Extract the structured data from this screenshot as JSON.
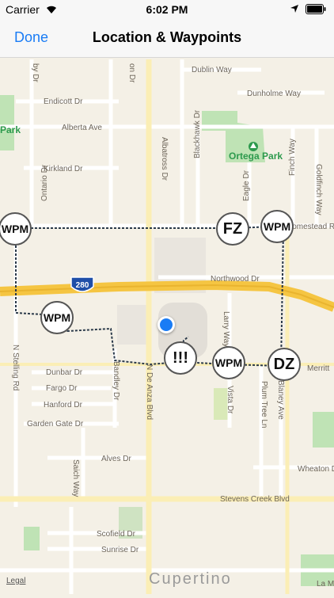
{
  "status": {
    "carrier": "Carrier",
    "time": "6:02 PM"
  },
  "nav": {
    "done": "Done",
    "title": "Location & Waypoints"
  },
  "map": {
    "streets": {
      "dublin": "Dublin Way",
      "dunholme": "Dunholme Way",
      "endicott": "Endicott Dr",
      "alberta": "Alberta Ave",
      "kirkland": "Kirkland Dr",
      "ontario": "Ontario Dr",
      "albatross": "Albatross Dr",
      "blackhawk": "Blackhawk Dr",
      "eagle": "Eagle Dr",
      "finch": "Finch Way",
      "goldfinch": "Goldfinch Way",
      "homestead": "Homestead Rd",
      "northwood": "Northwood Dr",
      "larry": "Larry Way",
      "dunbar": "Dunbar Dr",
      "fargo": "Fargo Dr",
      "hanford": "Hanford Dr",
      "garden_gate": "Garden Gate Dr",
      "bandley": "Bandley Dr",
      "de_anza": "N De Anza Blvd",
      "stelling": "N Stelling Rd",
      "vista": "Vista Dr",
      "plum_tree": "Plum Tree Ln",
      "blaney": "Blaney Ave",
      "merritt": "Merritt",
      "alves": "Alves Dr",
      "saich": "Saich Way",
      "wheaton": "Wheaton Dr",
      "stevens_creek": "Stevens Creek Blvd",
      "scofield": "Scofield Dr",
      "sunrise": "Sunrise Dr",
      "la_ma": "La Ma",
      "by_dr": "by Dr",
      "on_dr": "on Dr",
      "park": "Park",
      "ortega_park": "Ortega Park",
      "highway": "280"
    },
    "city": "Cupertino",
    "legal": "Legal"
  },
  "markers": {
    "wpm1": "WPM",
    "wpm2": "WPM",
    "wpm3": "WPM",
    "wpm4": "WPM",
    "fz": "FZ",
    "dz": "DZ",
    "alert": "!!!"
  },
  "colors": {
    "accent": "#1a7cf5",
    "highway": "#f5c542",
    "park": "#bfe3b5",
    "route": "#2b3a4a"
  }
}
